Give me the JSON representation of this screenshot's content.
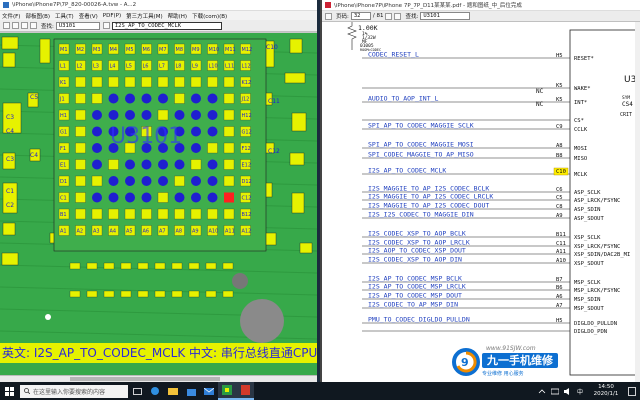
{
  "left_window": {
    "title": "\\iPhone\\iPhone7P\\7P_820-00026-A.tvw - A...2",
    "menu": [
      "文件(F)",
      "部板图(B)",
      "工具(T)",
      "查看(V)",
      "PDF(P)",
      "第三方工具(M)",
      "帮助(H)",
      "下载(com)(B)"
    ],
    "net_label": "查找:",
    "ref_field": "U3101",
    "net_field": "I2S_AP_TO_CODEC_MCLK",
    "bottom_caption": "英文: I2S_AP_TO_CODEC_MCLK 中文: 串行总线直通CPU复",
    "chip_label": "U3101",
    "bga_rows": [
      "M",
      "L",
      "K",
      "J",
      "H",
      "G",
      "F",
      "E",
      "D",
      "C",
      "B",
      "A"
    ],
    "bga_cols": [
      "1",
      "2",
      "3",
      "4",
      "5",
      "6",
      "7",
      "8",
      "9",
      "10",
      "11",
      "12"
    ],
    "parts": [
      "C3",
      "C4",
      "C1",
      "C2",
      "C3",
      "C4",
      "C5",
      "C10",
      "C11",
      "C12"
    ]
  },
  "right_window": {
    "title": "\\iPhone\\iPhone7P\\iPhone 7P_7P_D11某某某.pdf - 题和图纸_中_后位完成",
    "page_label": "页码:",
    "page_current": "32",
    "page_total": "/ 81",
    "find_label": "查找:",
    "find_field": "U3101",
    "resistor": {
      "value": "1.00K",
      "tol": "1%",
      "pkg": "1/32W",
      "code": "MF",
      "size": "01005",
      "extra": "ROOM=CODEC"
    },
    "chip_ref": "U3",
    "chip_side": [
      "CS4",
      "SYM",
      "CRIT"
    ],
    "nets": [
      {
        "name": "CODEC_RESET_L",
        "pin": "H5",
        "func": "RESET*"
      },
      {
        "name": "",
        "pin": "K5",
        "func": "WAKE*"
      },
      {
        "name": "AUDIO_TO_AOP_INT_L",
        "pin": "K5",
        "func": "INT*"
      },
      {
        "name": "",
        "pin": "",
        "func": "CS*"
      },
      {
        "name": "SPI_AP_TO_CODEC_MAGGIE_SCLK",
        "pin": "C9",
        "func": "CCLK"
      },
      {
        "name": "SPI_AP_TO_CODEC_MAGGIE_MOSI",
        "pin": "A8",
        "func": "MOSI"
      },
      {
        "name": "SPI_CODEC_MAGGIE_TO_AP_MISO",
        "pin": "B8",
        "func": "MISO"
      },
      {
        "name": "I2S_AP_TO_CODEC_MCLK",
        "pin": "C10",
        "func": "MCLK"
      },
      {
        "name": "I2S_MAGGIE_TO_AP_I2S_CODEC_BCLK",
        "pin": "C6",
        "func": "ASP_SCLK"
      },
      {
        "name": "I2S_MAGGIE_TO_AP_I2S_CODEC_LRCLK",
        "pin": "C5",
        "func": "ASP_LRCK/FSYNC"
      },
      {
        "name": "I2S_MAGGIE_TO_AP_I2S_CODEC_DOUT",
        "pin": "C8",
        "func": "ASP_SDIN"
      },
      {
        "name": "I2S_I2S_CODEC_TO_MAGGIE_DIN",
        "pin": "A9",
        "func": "ASP_SDOUT"
      },
      {
        "name": "I2S_CODEC_XSP_TO_AOP_BCLK",
        "pin": "B11",
        "func": "XSP_SCLK"
      },
      {
        "name": "I2S_CODEC_XSP_TO_AOP_LRCLK",
        "pin": "C11",
        "func": "XSP_LRCK/FSYNC"
      },
      {
        "name": "I2S_AOP_TO_CODEC_XSP_DOUT",
        "pin": "A11",
        "func": "XSP_SDIN/DAC2B_MI"
      },
      {
        "name": "I2S_CODEC_XSP_TO_AOP_DIN",
        "pin": "A10",
        "func": "XSP_SDOUT"
      },
      {
        "name": "I2S_AP_TO_CODEC_MSP_BCLK",
        "pin": "B7",
        "func": "MSP_SCLK"
      },
      {
        "name": "I2S_AP_TO_CODEC_MSP_LRCLK",
        "pin": "B6",
        "func": "MSP_LRCK/FSYNC"
      },
      {
        "name": "I2S_AP_TO_CODEC_MSP_DOUT",
        "pin": "A6",
        "func": "MSP_SDIN"
      },
      {
        "name": "I2S_CODEC_TO_AP_MSP_DIN",
        "pin": "A7",
        "func": "MSP_SDOUT"
      },
      {
        "name": "PMU_TO_CODEC_DIGLDO_PULLDN",
        "pin": "H5",
        "func": "DIGLDO_PULLDN"
      },
      {
        "name": "",
        "pin": "",
        "func": "DIGLDO_PDN"
      }
    ],
    "nc_labels": [
      "NC",
      "NC"
    ]
  },
  "watermark": {
    "url": "www.91SJW.com",
    "name": "九一手机维修",
    "tag": "专业维修 用心服务"
  },
  "taskbar": {
    "search_placeholder": "在这里输入你要搜索的内容",
    "time": "14:50",
    "date": "2020/1/1"
  },
  "colors": {
    "pcb_green": "#37a94a",
    "pad_yellow": "#e6f200",
    "via_blue": "#1f1fd0",
    "highlight_red": "#ff2020",
    "schematic_blue": "#1f3fbf",
    "mclk_pin": "#ffee00"
  }
}
